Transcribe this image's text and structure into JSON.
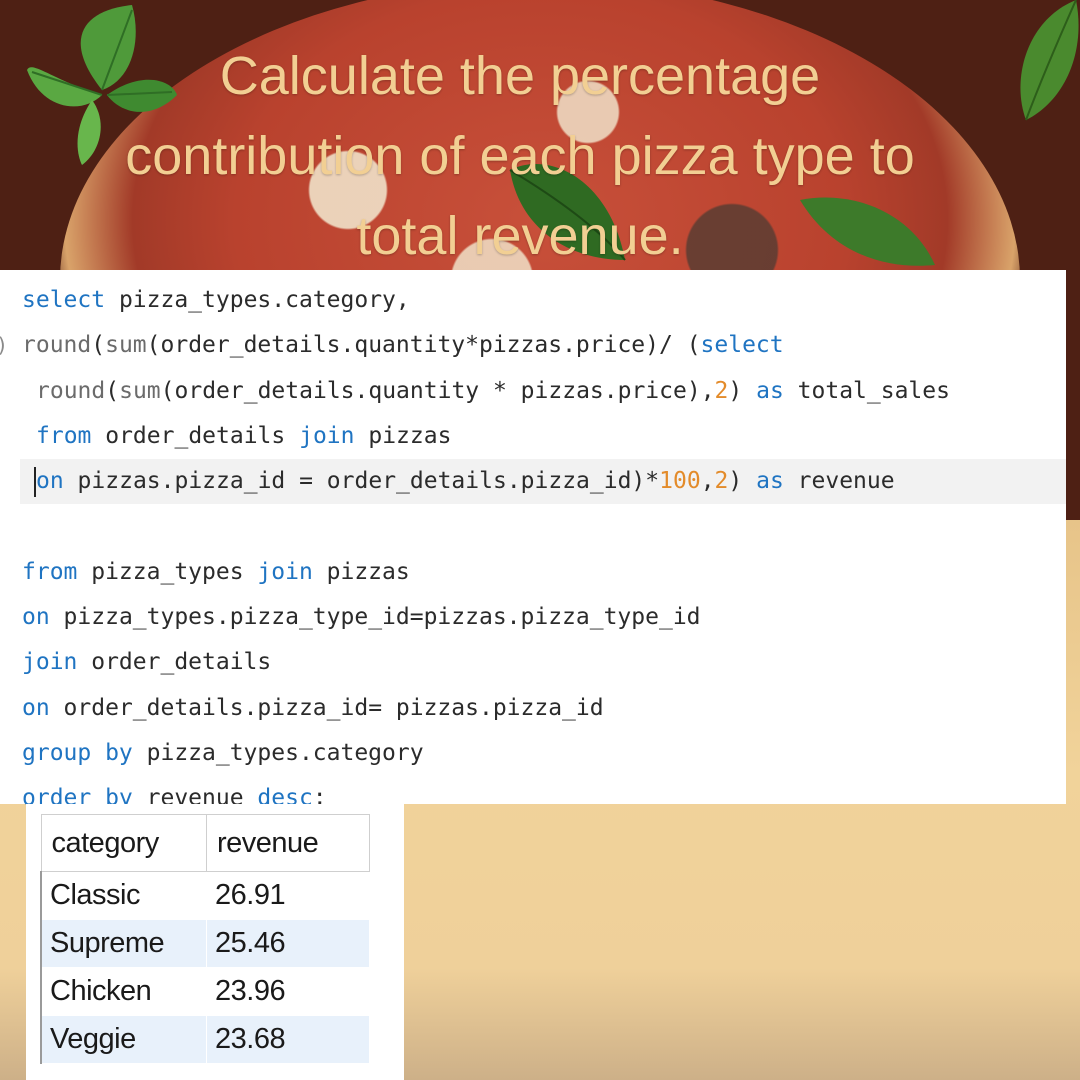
{
  "title": {
    "line1": "Calculate the percentage",
    "line2": "contribution of each pizza type to",
    "line3": "total revenue."
  },
  "code": {
    "line1_select": "select",
    "line1_rest": " pizza_types.category,",
    "line2_round": "round",
    "line2_paren": "(",
    "line2_sum": "sum",
    "line2_rest": "(order_details.quantity*pizzas.price)/ (",
    "line2_select": "select",
    "line3_round": "round",
    "line3_paren": "(",
    "line3_sum": "sum",
    "line3_rest": "(order_details.quantity * pizzas.price),",
    "line3_num": "2",
    "line3_close": ") ",
    "line3_as": "as",
    "line3_alias": " total_sales",
    "line4_from": "from",
    "line4_mid": " order_details ",
    "line4_join": "join",
    "line4_rest": " pizzas",
    "line5_on": "on",
    "line5_rest": " pizzas.pizza_id = order_details.pizza_id)*",
    "line5_num1": "100",
    "line5_comma": ",",
    "line5_num2": "2",
    "line5_close": ") ",
    "line5_as": "as",
    "line5_alias": " revenue",
    "line7_from": "from",
    "line7_mid": " pizza_types ",
    "line7_join": "join",
    "line7_rest": " pizzas",
    "line8_on": "on",
    "line8_rest": " pizza_types.pizza_type_id=pizzas.pizza_type_id",
    "line9_join": "join",
    "line9_rest": " order_details",
    "line10_on": "on",
    "line10_rest": " order_details.pizza_id= pizzas.pizza_id",
    "line11_group": "group by",
    "line11_rest": " pizza_types.category",
    "line12_order": "order by",
    "line12_mid": " revenue ",
    "line12_desc": "desc",
    "line12_semi": ";"
  },
  "results": {
    "headers": [
      "category",
      "revenue"
    ],
    "rows": [
      {
        "category": "Classic",
        "revenue": "26.91"
      },
      {
        "category": "Supreme",
        "revenue": "25.46"
      },
      {
        "category": "Chicken",
        "revenue": "23.96"
      },
      {
        "category": "Veggie",
        "revenue": "23.68"
      }
    ]
  },
  "colors": {
    "keyword": "#1f74c2",
    "number": "#e38b2a",
    "title": "#f2cf93",
    "background_top": "#4e2014",
    "background_bottom": "#edcf98"
  }
}
